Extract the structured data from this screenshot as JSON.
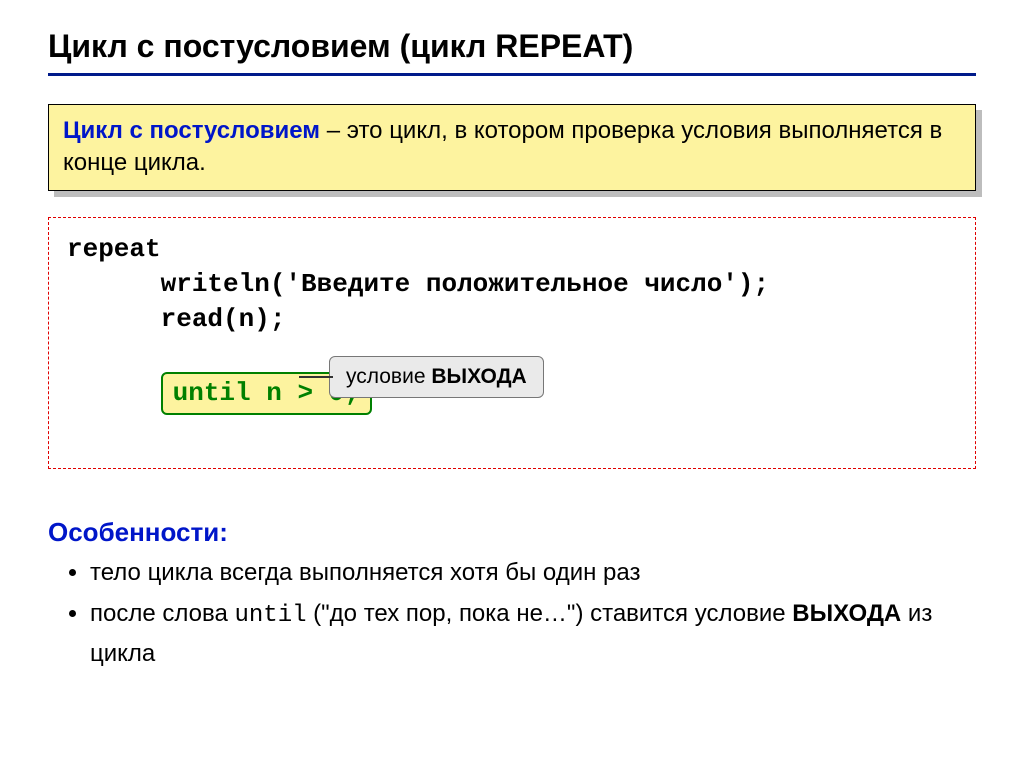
{
  "title": "Цикл с постусловием (цикл REPEAT)",
  "definition": {
    "term": "Цикл с постусловием",
    "rest": " – это цикл, в котором проверка условия выполняется в конце цикла."
  },
  "code": {
    "l1": "repeat",
    "l2": "      writeln('Введите положительное число');",
    "l3": "      read(n);",
    "until": "until n > 0;"
  },
  "callout": {
    "pre": "условие ",
    "bold": "ВЫХОДА"
  },
  "features": {
    "heading": "Особенности:",
    "item1": "тело цикла всегда выполняется хотя бы один раз",
    "item2_pre": "после слова ",
    "item2_mono": "until",
    "item2_mid": " (\"до тех пор, пока не…\") ставится условие ",
    "item2_bold": "ВЫХОДА",
    "item2_post": " из цикла"
  }
}
